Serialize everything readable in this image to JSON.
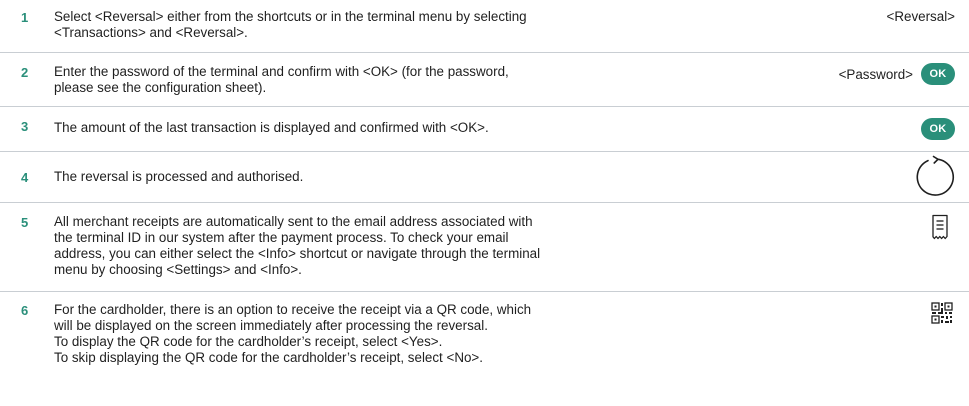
{
  "steps": [
    {
      "number": "1",
      "lines": [
        "Select <Reversal> either from the shortcuts or in the terminal menu by selecting",
        "<Transactions> and <Reversal>."
      ],
      "right_label": "<Reversal>"
    },
    {
      "number": "2",
      "lines": [
        "Enter the password of the terminal and confirm with <OK> (for the password,",
        "please see the configuration sheet)."
      ],
      "right_label": "<Password>",
      "button": "OK"
    },
    {
      "number": "3",
      "lines": [
        "The amount of the last transaction is displayed and confirmed with <OK>."
      ],
      "button": "OK",
      "icon": "ok-button-icon"
    },
    {
      "number": "4",
      "lines": [
        "The reversal is processed and authorised."
      ],
      "icon": "processing-circle-icon"
    },
    {
      "number": "5",
      "lines": [
        "All merchant receipts are automatically sent to the email address associated with",
        "the terminal ID in our system after the payment process. To check your email",
        "address, you can either select the <Info> shortcut or navigate through the terminal",
        "menu by choosing <Settings> and <Info>."
      ],
      "icon": "receipt-icon"
    },
    {
      "number": "6",
      "lines": [
        "For the cardholder, there is an option to receive the receipt via a QR code, which",
        "will be displayed on the screen immediately after processing the reversal.",
        "To display the QR code for the cardholder’s receipt, select <Yes>.",
        "To skip displaying the QR code for the cardholder’s receipt, select <No>."
      ],
      "icon": "qr-code-icon"
    }
  ],
  "colors": {
    "accent": "#2a8f7a",
    "divider": "#c9ced3",
    "text": "#1f1f1f"
  }
}
